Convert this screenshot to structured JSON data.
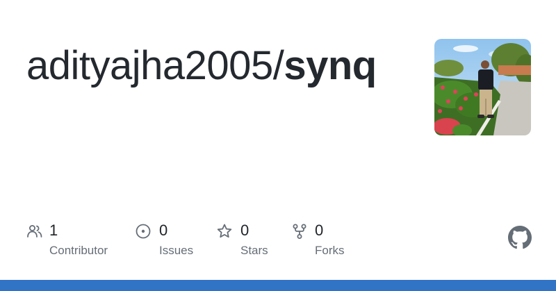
{
  "repo": {
    "owner": "adityajha2005/",
    "name": "synq"
  },
  "stats": [
    {
      "icon": "people-icon",
      "count": "1",
      "label": "Contributor"
    },
    {
      "icon": "issue-icon",
      "count": "0",
      "label": "Issues"
    },
    {
      "icon": "star-icon",
      "count": "0",
      "label": "Stars"
    },
    {
      "icon": "fork-icon",
      "count": "0",
      "label": "Forks"
    }
  ],
  "colors": {
    "title": "#24292f",
    "count": "#1f2328",
    "label": "#656d76",
    "icon": "#656d76",
    "bottom_bar": "#3173c5"
  }
}
